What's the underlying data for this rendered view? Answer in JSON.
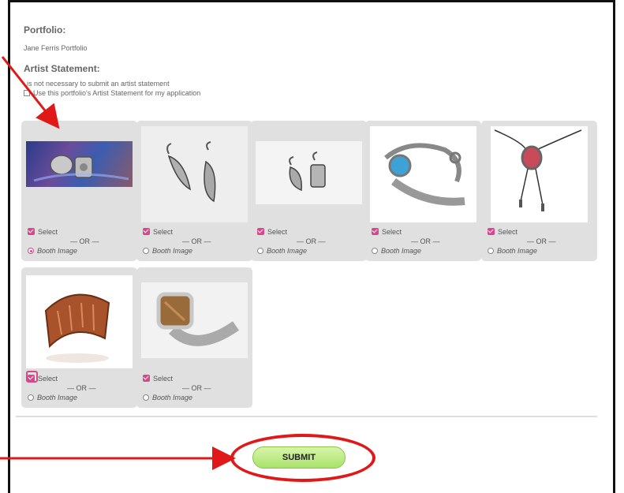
{
  "portfolio": {
    "heading": "Portfolio:",
    "name": "Jane Ferris Portfolio"
  },
  "artist_statement": {
    "heading": "Artist Statement:",
    "note": "is not necessary to submit an artist statement",
    "checkbox_label": "Use this portfolio's Artist Statement for my application"
  },
  "images": [
    {
      "select_label": "Select",
      "or_label": "— OR —",
      "booth_label": "Booth Image",
      "selected": true,
      "booth": true,
      "icon": "earrings-on-blue-icon"
    },
    {
      "select_label": "Select",
      "or_label": "— OR —",
      "booth_label": "Booth Image",
      "selected": true,
      "booth": false,
      "icon": "earrings-icon"
    },
    {
      "select_label": "Select",
      "or_label": "— OR —",
      "booth_label": "Booth Image",
      "selected": true,
      "booth": false,
      "icon": "small-earrings-icon"
    },
    {
      "select_label": "Select",
      "or_label": "— OR —",
      "booth_label": "Booth Image",
      "selected": true,
      "booth": false,
      "icon": "turquoise-bracelet-icon"
    },
    {
      "select_label": "Select",
      "or_label": "— OR —",
      "booth_label": "Booth Image",
      "selected": true,
      "booth": false,
      "icon": "bolo-pendant-icon"
    },
    {
      "select_label": "Select",
      "or_label": "— OR —",
      "booth_label": "Booth Image",
      "selected": true,
      "booth": false,
      "icon": "copper-cuff-icon"
    },
    {
      "select_label": "Select",
      "or_label": "— OR —",
      "booth_label": "Booth Image",
      "selected": true,
      "booth": false,
      "icon": "stone-ring-icon"
    }
  ],
  "submit": {
    "label": "SUBMIT"
  },
  "colors": {
    "accent": "#d6478c",
    "annotation": "#e01818",
    "submit_green": "#a9e26b"
  }
}
